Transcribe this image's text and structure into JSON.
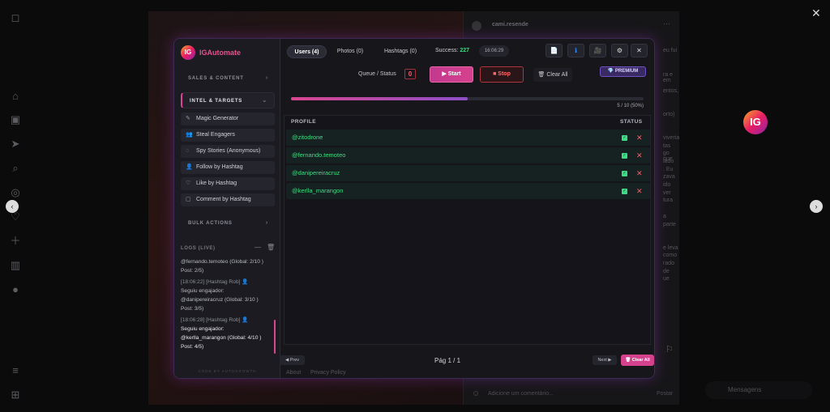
{
  "post": {
    "username": "cami.resende",
    "comment_placeholder": "Adicione um comentário...",
    "post_button": "Postar",
    "side_snippets": [
      "eu fui",
      "ra e em",
      "entos,",
      "orto)",
      "viveria",
      "tas",
      "go que",
      "lado",
      ". Eu",
      "zava",
      "ido",
      "ver",
      "tura",
      "a",
      "parte",
      "e leva",
      "como",
      "rado",
      "de",
      "ue"
    ]
  },
  "app": {
    "logo_initials": "IG",
    "title": "IGAutomate",
    "sidebar": {
      "sections": [
        {
          "label": "SALES & CONTENT",
          "chevron": "›"
        },
        {
          "label": "INTEL & TARGETS",
          "chevron": "⌄"
        },
        {
          "label": "BULK ACTIONS",
          "chevron": "›"
        }
      ],
      "menu_items": [
        {
          "label": "Magic Generator",
          "icon": "✎"
        },
        {
          "label": "Steal Engagers",
          "icon": "👥"
        },
        {
          "label": "Spy Stories (Anonymous)",
          "icon": "◌"
        },
        {
          "label": "Follow by Hashtag",
          "icon": "👤"
        },
        {
          "label": "Like by Hashtag",
          "icon": "♡"
        },
        {
          "label": "Comment by Hashtag",
          "icon": "▢"
        }
      ],
      "logs_title": "LOGS (LIVE)",
      "logs": [
        "@fernando.temoteo (Global: 2/10 )",
        "Post: 2/5)",
        "[18:06:22] [Hashtag Rob] 👤",
        "Seguiu engajador:",
        "@danipereiracruz (Global: 3/10 )",
        "Post: 3/5)",
        "[18:06:28] [Hashtag Rob] 👤",
        "Seguiu engajador:",
        "@kerlla_marangon (Global: 4/10 )",
        "Post: 4/5)"
      ],
      "footer_brand": "CODE BY AUTOGROWTH"
    },
    "tabs": [
      {
        "label": "Users (4)"
      },
      {
        "label": "Photos (0)"
      },
      {
        "label": "Hashtags (0)"
      }
    ],
    "success_label": "Success:",
    "success_value": "227",
    "time": "16:06:29",
    "queue_label": "Queue / Status",
    "queue_count": "0",
    "start_label": "▶ Start",
    "stop_label": "■ Stop",
    "clear_label": "🗑 Clear All",
    "premium_label": "💎 PREMIUM",
    "progress": {
      "fraction": 0.5,
      "text": "5 / 10 (50%)"
    },
    "table": {
      "col_profile": "PROFILE",
      "col_status": "STATUS",
      "rows": [
        {
          "user": "@zitodrone"
        },
        {
          "user": "@fernando.temoteo"
        },
        {
          "user": "@danipereiracruz"
        },
        {
          "user": "@kerlla_marangon"
        }
      ]
    },
    "pager": {
      "prev": "◀ Prev",
      "text": "Pág 1 / 1",
      "next": "Next ▶",
      "clear_all": "🗑 Clear All"
    },
    "links": [
      "About",
      "Privacy Policy"
    ]
  },
  "ui": {
    "messages_label": "Mensagens",
    "float_badge": "IG"
  }
}
